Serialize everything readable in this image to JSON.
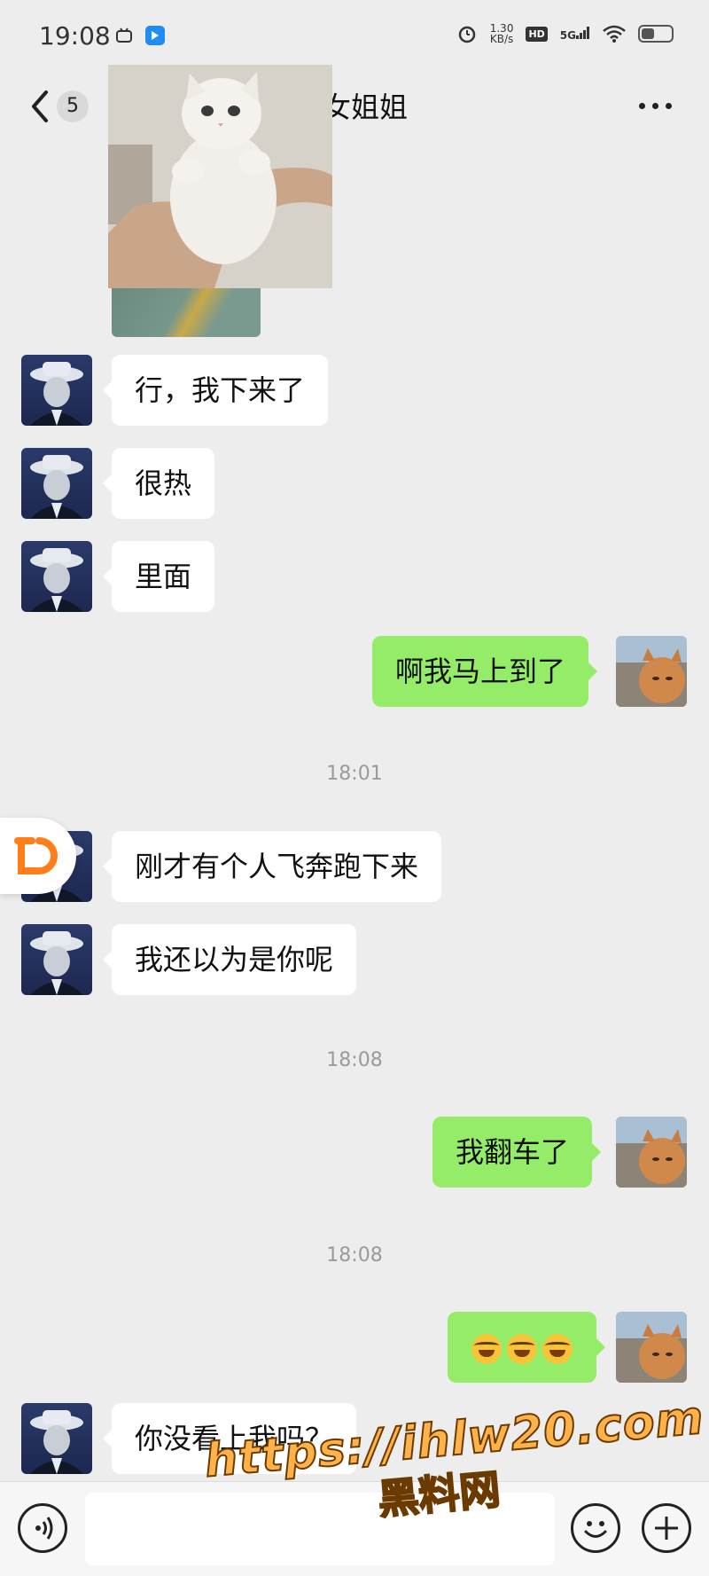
{
  "status_bar": {
    "time": "19:08",
    "network_speed": "1.30",
    "network_speed_unit": "KB/s",
    "hd_label": "HD",
    "signal_label": "5G"
  },
  "header": {
    "unread_count": "5",
    "title": "女姐姐"
  },
  "messages": [
    {
      "side": "left",
      "text": "行，我下来了"
    },
    {
      "side": "left",
      "text": "很热"
    },
    {
      "side": "left",
      "text": "里面"
    },
    {
      "side": "right",
      "text": "啊我马上到了"
    },
    {
      "timestamp": "18:01"
    },
    {
      "side": "left",
      "text": "刚才有个人飞奔跑下来"
    },
    {
      "side": "left",
      "text": "我还以为是你呢"
    },
    {
      "timestamp": "18:08"
    },
    {
      "side": "right",
      "text": "我翻车了"
    },
    {
      "timestamp": "18:08"
    },
    {
      "side": "right",
      "emoji": [
        "rolling-laughing-emoji",
        "rolling-laughing-emoji",
        "rolling-laughing-emoji"
      ]
    },
    {
      "side": "left",
      "text": "你没看上我吗？"
    }
  ],
  "timestamps": [
    "18:01",
    "18:08",
    "18:08"
  ],
  "watermark": {
    "url": "https://ihlw20.com",
    "site_name": "黑料网"
  },
  "colors": {
    "background": "#ededed",
    "outgoing_bubble": "#95ec69",
    "incoming_bubble": "#ffffff",
    "watermark": "#ffb14a",
    "didi_brand": "#ff7e1a"
  }
}
